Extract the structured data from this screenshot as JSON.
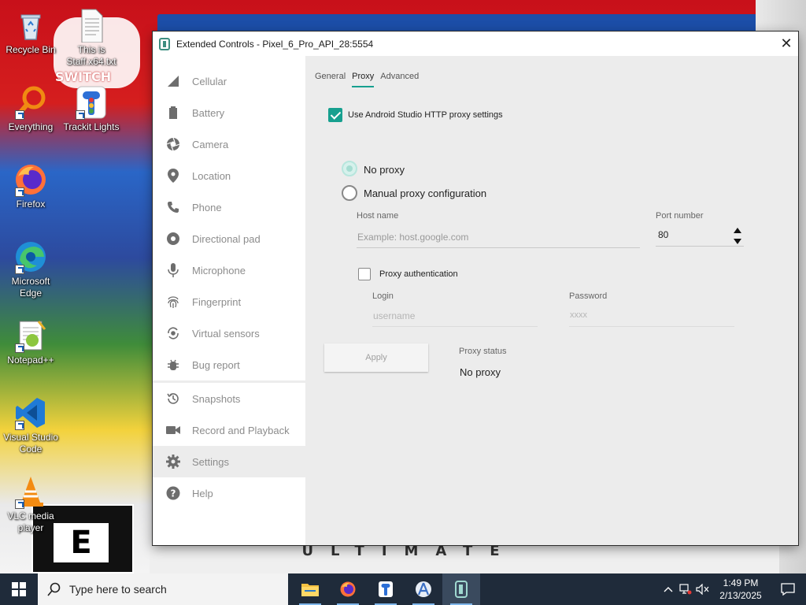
{
  "desktop": {
    "wallpaper_text": {
      "top": "SWITCH",
      "bottom": "ULTIMATE",
      "rating": "E"
    },
    "icons": [
      {
        "label": "Recycle Bin",
        "icon": "recycle-bin-icon"
      },
      {
        "label": "This is Staff.x64.txt",
        "icon": "text-file-icon"
      },
      {
        "label": "Everything",
        "icon": "everything-search-icon"
      },
      {
        "label": "Trackit Lights",
        "icon": "traffic-light-icon"
      },
      {
        "label": "Firefox",
        "icon": "firefox-icon"
      },
      {
        "label": "Microsoft Edge",
        "icon": "edge-icon"
      },
      {
        "label": "Notepad++",
        "icon": "notepad-plus-plus-icon"
      },
      {
        "label": "Visual Studio Code",
        "icon": "vscode-icon"
      },
      {
        "label": "VLC media player",
        "icon": "vlc-icon"
      }
    ]
  },
  "window": {
    "title": "Extended Controls - Pixel_6_Pro_API_28:5554",
    "close_glyph": "✕",
    "accent": "#17a08f"
  },
  "sidebar": {
    "items": [
      {
        "label": "Cellular",
        "icon": "signal-icon"
      },
      {
        "label": "Battery",
        "icon": "battery-icon"
      },
      {
        "label": "Camera",
        "icon": "camera-aperture-icon"
      },
      {
        "label": "Location",
        "icon": "location-pin-icon"
      },
      {
        "label": "Phone",
        "icon": "phone-icon"
      },
      {
        "label": "Directional pad",
        "icon": "dpad-icon"
      },
      {
        "label": "Microphone",
        "icon": "microphone-icon"
      },
      {
        "label": "Fingerprint",
        "icon": "fingerprint-icon"
      },
      {
        "label": "Virtual sensors",
        "icon": "rotate-sensor-icon"
      },
      {
        "label": "Bug report",
        "icon": "bug-icon"
      },
      {
        "label": "Snapshots",
        "icon": "history-icon"
      },
      {
        "label": "Record and Playback",
        "icon": "video-camera-icon"
      },
      {
        "label": "Settings",
        "icon": "gear-icon"
      },
      {
        "label": "Help",
        "icon": "help-icon"
      }
    ],
    "active": "Settings"
  },
  "tabs": [
    {
      "label": "General",
      "active": false
    },
    {
      "label": "Proxy",
      "active": true
    },
    {
      "label": "Advanced",
      "active": false
    }
  ],
  "proxy": {
    "use_studio_label": "Use Android Studio HTTP proxy settings",
    "use_studio_checked": true,
    "no_proxy_label": "No proxy",
    "manual_label": "Manual proxy configuration",
    "selected_mode": "No proxy",
    "host_label": "Host name",
    "host_placeholder": "Example: host.google.com",
    "port_label": "Port number",
    "port_value": "80",
    "auth_label": "Proxy authentication",
    "auth_checked": false,
    "login_label": "Login",
    "login_placeholder": "username",
    "password_label": "Password",
    "password_placeholder": "xxxx",
    "apply_label": "Apply",
    "status_label": "Proxy status",
    "status_value": "No proxy"
  },
  "taskbar": {
    "search_placeholder": "Type here to search",
    "apps": [
      {
        "name": "File Explorer",
        "icon": "folder-icon"
      },
      {
        "name": "Firefox",
        "icon": "firefox-icon"
      },
      {
        "name": "Trackit Lights",
        "icon": "traffic-light-icon"
      },
      {
        "name": "Android Studio",
        "icon": "android-studio-icon"
      },
      {
        "name": "Emulator Extended Controls",
        "icon": "emulator-icon"
      }
    ],
    "time": "1:49 PM",
    "date": "2/13/2025"
  }
}
